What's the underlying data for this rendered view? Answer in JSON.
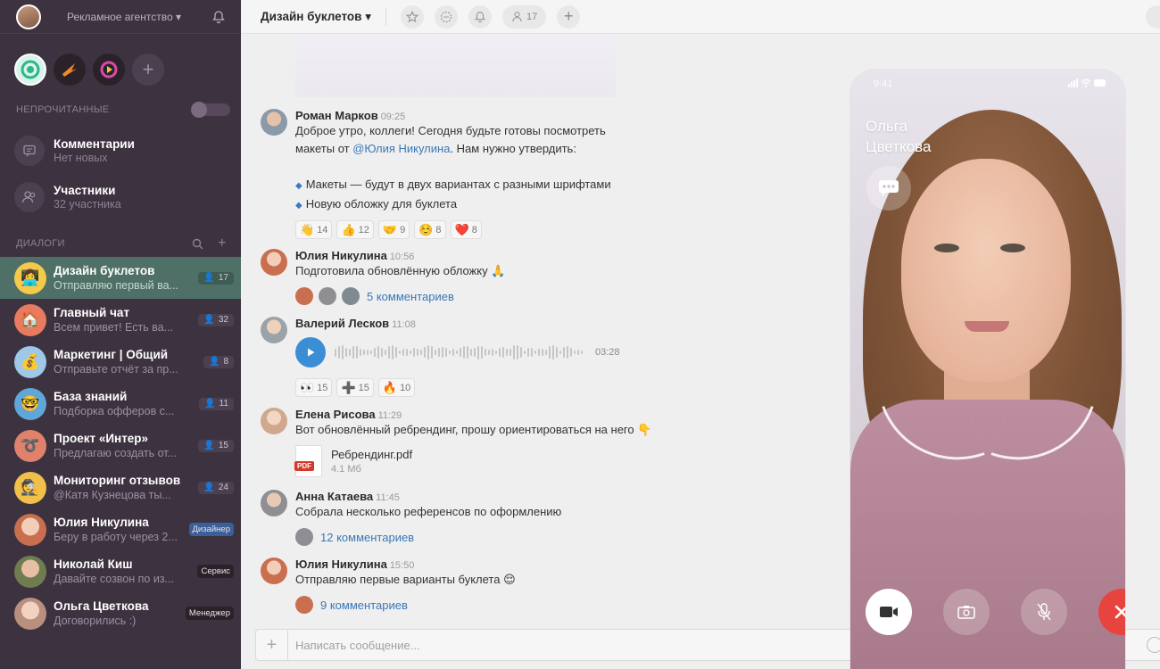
{
  "sidebar": {
    "workspace": "Рекламное агентство",
    "unread_header": "НЕПРОЧИТАННЫЕ",
    "comments": {
      "title": "Комментарии",
      "subtitle": "Нет новых"
    },
    "members": {
      "title": "Участники",
      "subtitle": "32 участника"
    },
    "dialogs_header": "ДИАЛОГИ",
    "dialogs": [
      {
        "name": "Дизайн буклетов",
        "preview": "Отправляю первый ва...",
        "count": "17",
        "emoji": "👩‍💻",
        "bg": "#f5c94a"
      },
      {
        "name": "Главный чат",
        "preview": "Всем привет! Есть ва...",
        "count": "32",
        "emoji": "🏠",
        "bg": "#e87b5e"
      },
      {
        "name": "Маркетинг | Общий",
        "preview": "Отправьте отчёт за пр...",
        "count": "8",
        "emoji": "💰",
        "bg": "#9fc7e8"
      },
      {
        "name": "База знаний",
        "preview": "Подборка офферов с...",
        "count": "11",
        "emoji": "🤓",
        "bg": "#5fa6d9"
      },
      {
        "name": "Проект «Интер»",
        "preview": "Предлагаю создать от...",
        "count": "15",
        "emoji": "➰",
        "bg": "#e0826b"
      },
      {
        "name": "Мониторинг отзывов",
        "preview": "@Катя Кузнецова ты...",
        "count": "24",
        "emoji": "🕵️",
        "bg": "#f0c04b"
      },
      {
        "name": "Юлия Никулина",
        "preview": "Беру в работу через 2...",
        "tag": "Дизайнер",
        "bg": "#c96f4f"
      },
      {
        "name": "Николай Киш",
        "preview": "Давайте созвон по из...",
        "tag": "Сервис",
        "bg": "#7a8a5a"
      },
      {
        "name": "Ольга Цветкова",
        "preview": "Договорились :)",
        "tag": "Менеджер",
        "bg": "#d7b2a8"
      }
    ]
  },
  "topbar": {
    "channel": "Дизайн буклетов",
    "members_count": "17"
  },
  "messages": [
    {
      "author": "Роман Марков",
      "time": "09:25",
      "color": "#8a9aa8",
      "line1": "Доброе утро, коллеги! Сегодня будьте готовы посмотреть",
      "line2_pre": "макеты от",
      "mention": "@Юлия Никулина",
      "line2_post": ". Нам нужно утвердить:",
      "bullets": [
        "Макеты — будут в двух вариантах с разными шрифтами",
        "Новую обложку для буклета"
      ],
      "reactions": [
        {
          "emoji": "👋",
          "count": "14"
        },
        {
          "emoji": "👍",
          "count": "12"
        },
        {
          "emoji": "🤝",
          "count": "9"
        },
        {
          "emoji": "☺️",
          "count": "8"
        },
        {
          "emoji": "❤️",
          "count": "8"
        }
      ]
    },
    {
      "author": "Юлия Никулина",
      "time": "10:56",
      "color": "#c96f4f",
      "text": "Подготовила обновлённую обложку 🙏",
      "thread": "5 комментариев"
    },
    {
      "author": "Валерий Лесков",
      "time": "11:08",
      "color": "#9aa4a8",
      "duration": "03:28",
      "reactions": [
        {
          "emoji": "👀",
          "count": "15"
        },
        {
          "emoji": "➕",
          "count": "15"
        },
        {
          "emoji": "🔥",
          "count": "10"
        }
      ]
    },
    {
      "author": "Елена Рисова",
      "time": "11:29",
      "color": "#d0a78f",
      "text": "Вот обновлённый ребрендинг, прошу ориентироваться на него 👇",
      "file_name": "Ребрендинг.pdf",
      "file_size": "4.1 Мб",
      "file_type": "PDF"
    },
    {
      "author": "Анна Катаева",
      "time": "11:45",
      "color": "#8f8f93",
      "text": "Собрала несколько референсов по оформлению",
      "thread": "12 комментариев"
    },
    {
      "author": "Юлия Никулина",
      "time": "15:50",
      "color": "#c96f4f",
      "text": "Отправляю первые варианты буклета 😌",
      "thread": "9 комментариев"
    }
  ],
  "composer": {
    "placeholder": "Написать сообщение..."
  },
  "call": {
    "time": "9:41",
    "caller_first": "Ольга",
    "caller_last": "Цветкова"
  }
}
